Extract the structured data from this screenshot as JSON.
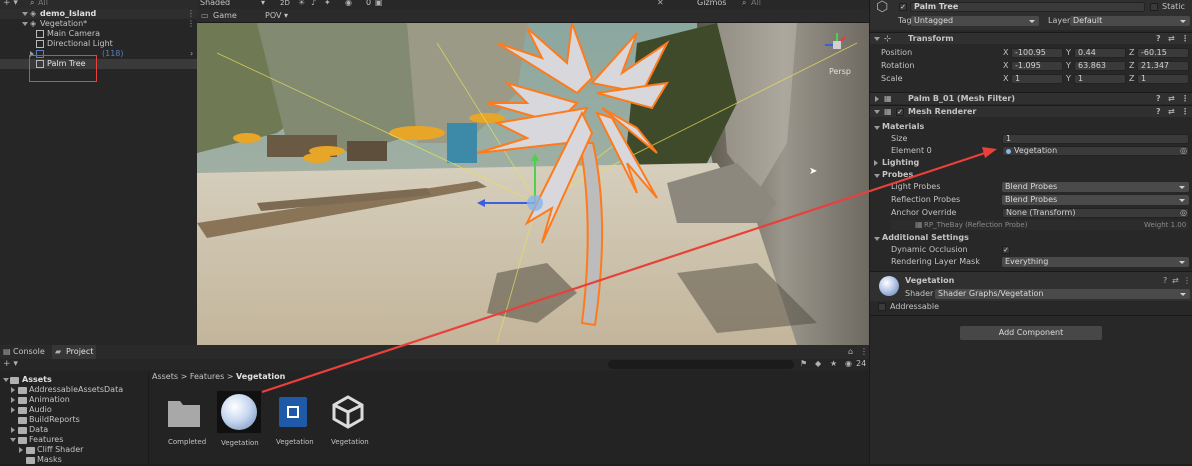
{
  "hierarchy": {
    "search_placeholder": "All",
    "scene_name": "demo_Island",
    "items": [
      {
        "label": "Vegetation*"
      },
      {
        "label": "Main Camera"
      },
      {
        "label": "Directional Light"
      },
      {
        "label": "(118)"
      },
      {
        "label": "Palm Tree"
      }
    ]
  },
  "scene_toolbar": {
    "shading_mode": "Shaded",
    "mode_2d": "2D",
    "hidden_count": "0",
    "gizmos_label": "Gizmos",
    "search_placeholder": "All"
  },
  "game_toolbar": {
    "game_tab": "Game",
    "camera": "POV"
  },
  "gizmo": {
    "projection": "Persp"
  },
  "inspector": {
    "object_name": "Palm Tree",
    "static_label": "Static",
    "tag_label": "Tag",
    "tag_value": "Untagged",
    "layer_label": "Layer",
    "layer_value": "Default",
    "transform": {
      "title": "Transform",
      "position_label": "Position",
      "rotation_label": "Rotation",
      "scale_label": "Scale",
      "position": {
        "x": "-100.95",
        "y": "0.44",
        "z": "-60.15"
      },
      "rotation": {
        "x": "-1.095",
        "y": "63.863",
        "z": "21.347"
      },
      "scale": {
        "x": "1",
        "y": "1",
        "z": "1"
      }
    },
    "mesh_filter_title": "Palm B_01 (Mesh Filter)",
    "mesh_renderer": {
      "title": "Mesh Renderer",
      "materials_label": "Materials",
      "size_label": "Size",
      "size_value": "1",
      "element0_label": "Element 0",
      "element0_value": "Vegetation",
      "lighting_label": "Lighting",
      "probes_label": "Probes",
      "light_probes_label": "Light Probes",
      "light_probes_value": "Blend Probes",
      "reflection_probes_label": "Reflection Probes",
      "reflection_probes_value": "Blend Probes",
      "anchor_override_label": "Anchor Override",
      "anchor_override_value": "None (Transform)",
      "probe_ref": "RP_TheBay (Reflection Probe)",
      "weight_label": "Weight 1.00",
      "additional_settings_label": "Additional Settings",
      "dynamic_occlusion_label": "Dynamic Occlusion",
      "rendering_layer_label": "Rendering Layer Mask",
      "rendering_layer_value": "Everything"
    },
    "material": {
      "name": "Vegetation",
      "shader_label": "Shader",
      "shader_value": "Shader Graphs/Vegetation"
    },
    "addressable_label": "Addressable",
    "add_component": "Add Component"
  },
  "bottom": {
    "console_tab": "Console",
    "project_tab": "Project",
    "breadcrumb": [
      "Assets",
      "Features",
      "Vegetation"
    ],
    "layer_count": "24",
    "tree": [
      {
        "label": "Assets"
      },
      {
        "label": "AddressableAssetsData"
      },
      {
        "label": "Animation"
      },
      {
        "label": "Audio"
      },
      {
        "label": "BuildReports"
      },
      {
        "label": "Data"
      },
      {
        "label": "Features"
      },
      {
        "label": "Cliff Shader"
      },
      {
        "label": "Masks"
      }
    ],
    "assets": [
      {
        "label": "Completed"
      },
      {
        "label": "Vegetation"
      },
      {
        "label": "Vegetation"
      },
      {
        "label": "Vegetation"
      }
    ]
  },
  "colors": {
    "annotation_red": "#e8403a",
    "selection_orange": "#ff7a1a",
    "selected_row": "#3a3a3a"
  }
}
